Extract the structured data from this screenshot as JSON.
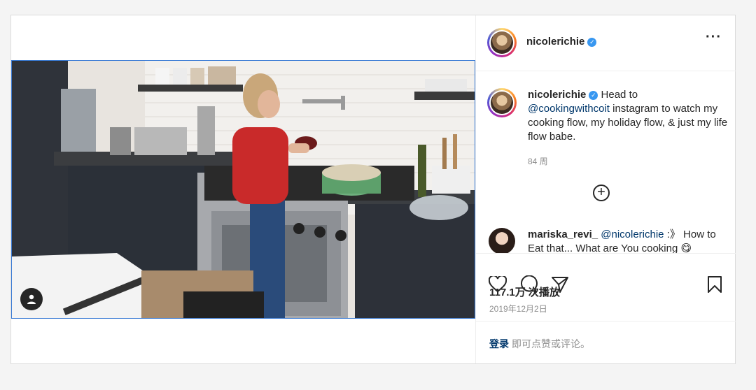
{
  "post": {
    "username": "nicolerichie",
    "more_icon": "more-horizontal-icon",
    "caption": {
      "username": "nicolerichie",
      "text_before": " Head to ",
      "mention": "@cookingwithcoit",
      "text_after": " instagram to watch my cooking flow, my holiday flow, & just my life flow babe."
    },
    "caption_time": "84 周",
    "comment": {
      "username": "mariska_revi_",
      "mention": "@nicolerichie",
      "text": " :》 How to Eat that... What are You cooking 😋"
    },
    "plays": "117.1万 次播放",
    "date": "2019年12月2日",
    "login_link": "登录",
    "login_text": "即可点赞或评论。"
  },
  "colors": {
    "verified": "#3897f0",
    "link": "#00376b",
    "muted": "#8e8e8e",
    "video_border": "#3a7bd5"
  }
}
